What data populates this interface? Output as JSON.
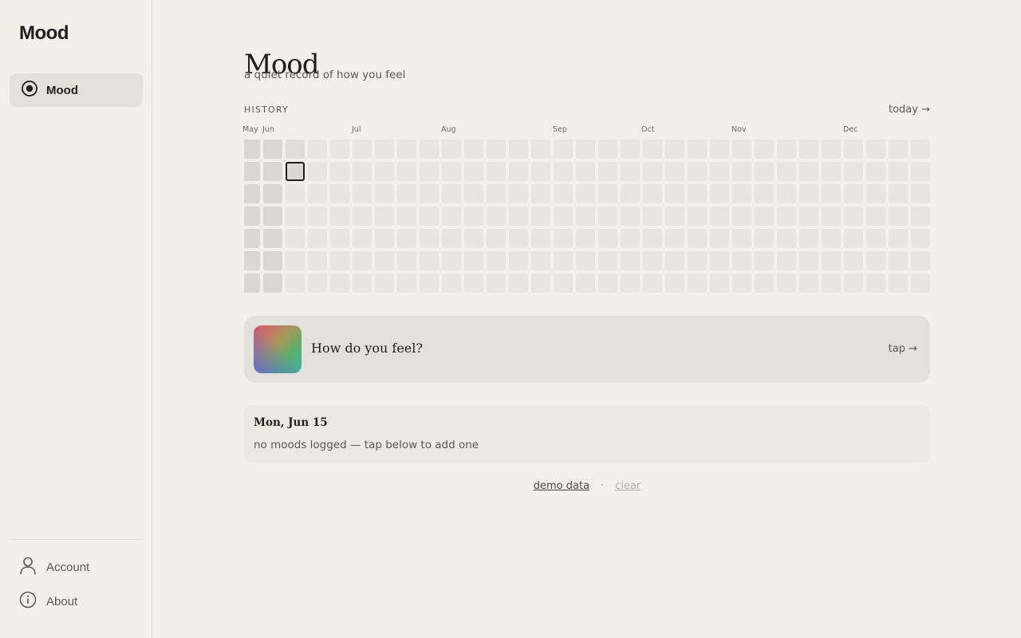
{
  "app": {
    "title": "Mood"
  },
  "sidebar": {
    "items": [
      {
        "label": "Mood",
        "icon": "radio-dot-icon",
        "active": true
      }
    ],
    "footer": [
      {
        "label": "Account",
        "icon": "user-icon"
      },
      {
        "label": "About",
        "icon": "info-icon"
      }
    ]
  },
  "page": {
    "title": "Mood",
    "subtitle": "a quiet record of how you feel"
  },
  "history": {
    "label": "HISTORY",
    "today_link": "today →",
    "months": [
      "May",
      "Jun",
      "Jul",
      "Aug",
      "Sep",
      "Oct",
      "Nov",
      "Dec"
    ],
    "weeks": 31,
    "days_per_week": 7,
    "past_weeks": 2,
    "selected": {
      "week": 2,
      "day": 1
    },
    "colors": {
      "past": "#dbd8d2",
      "future": "#e8e6e0",
      "selected_border": "#1f1e1c",
      "partial": "#e0ddd7"
    }
  },
  "prompt": {
    "text": "How do you feel?",
    "tap_label": "tap →"
  },
  "day": {
    "title": "Mon, Jun 15",
    "empty_text": "no moods logged — tap below to add one"
  },
  "footer": {
    "demo_label": "demo data",
    "separator": "·",
    "clear_label": "clear"
  }
}
